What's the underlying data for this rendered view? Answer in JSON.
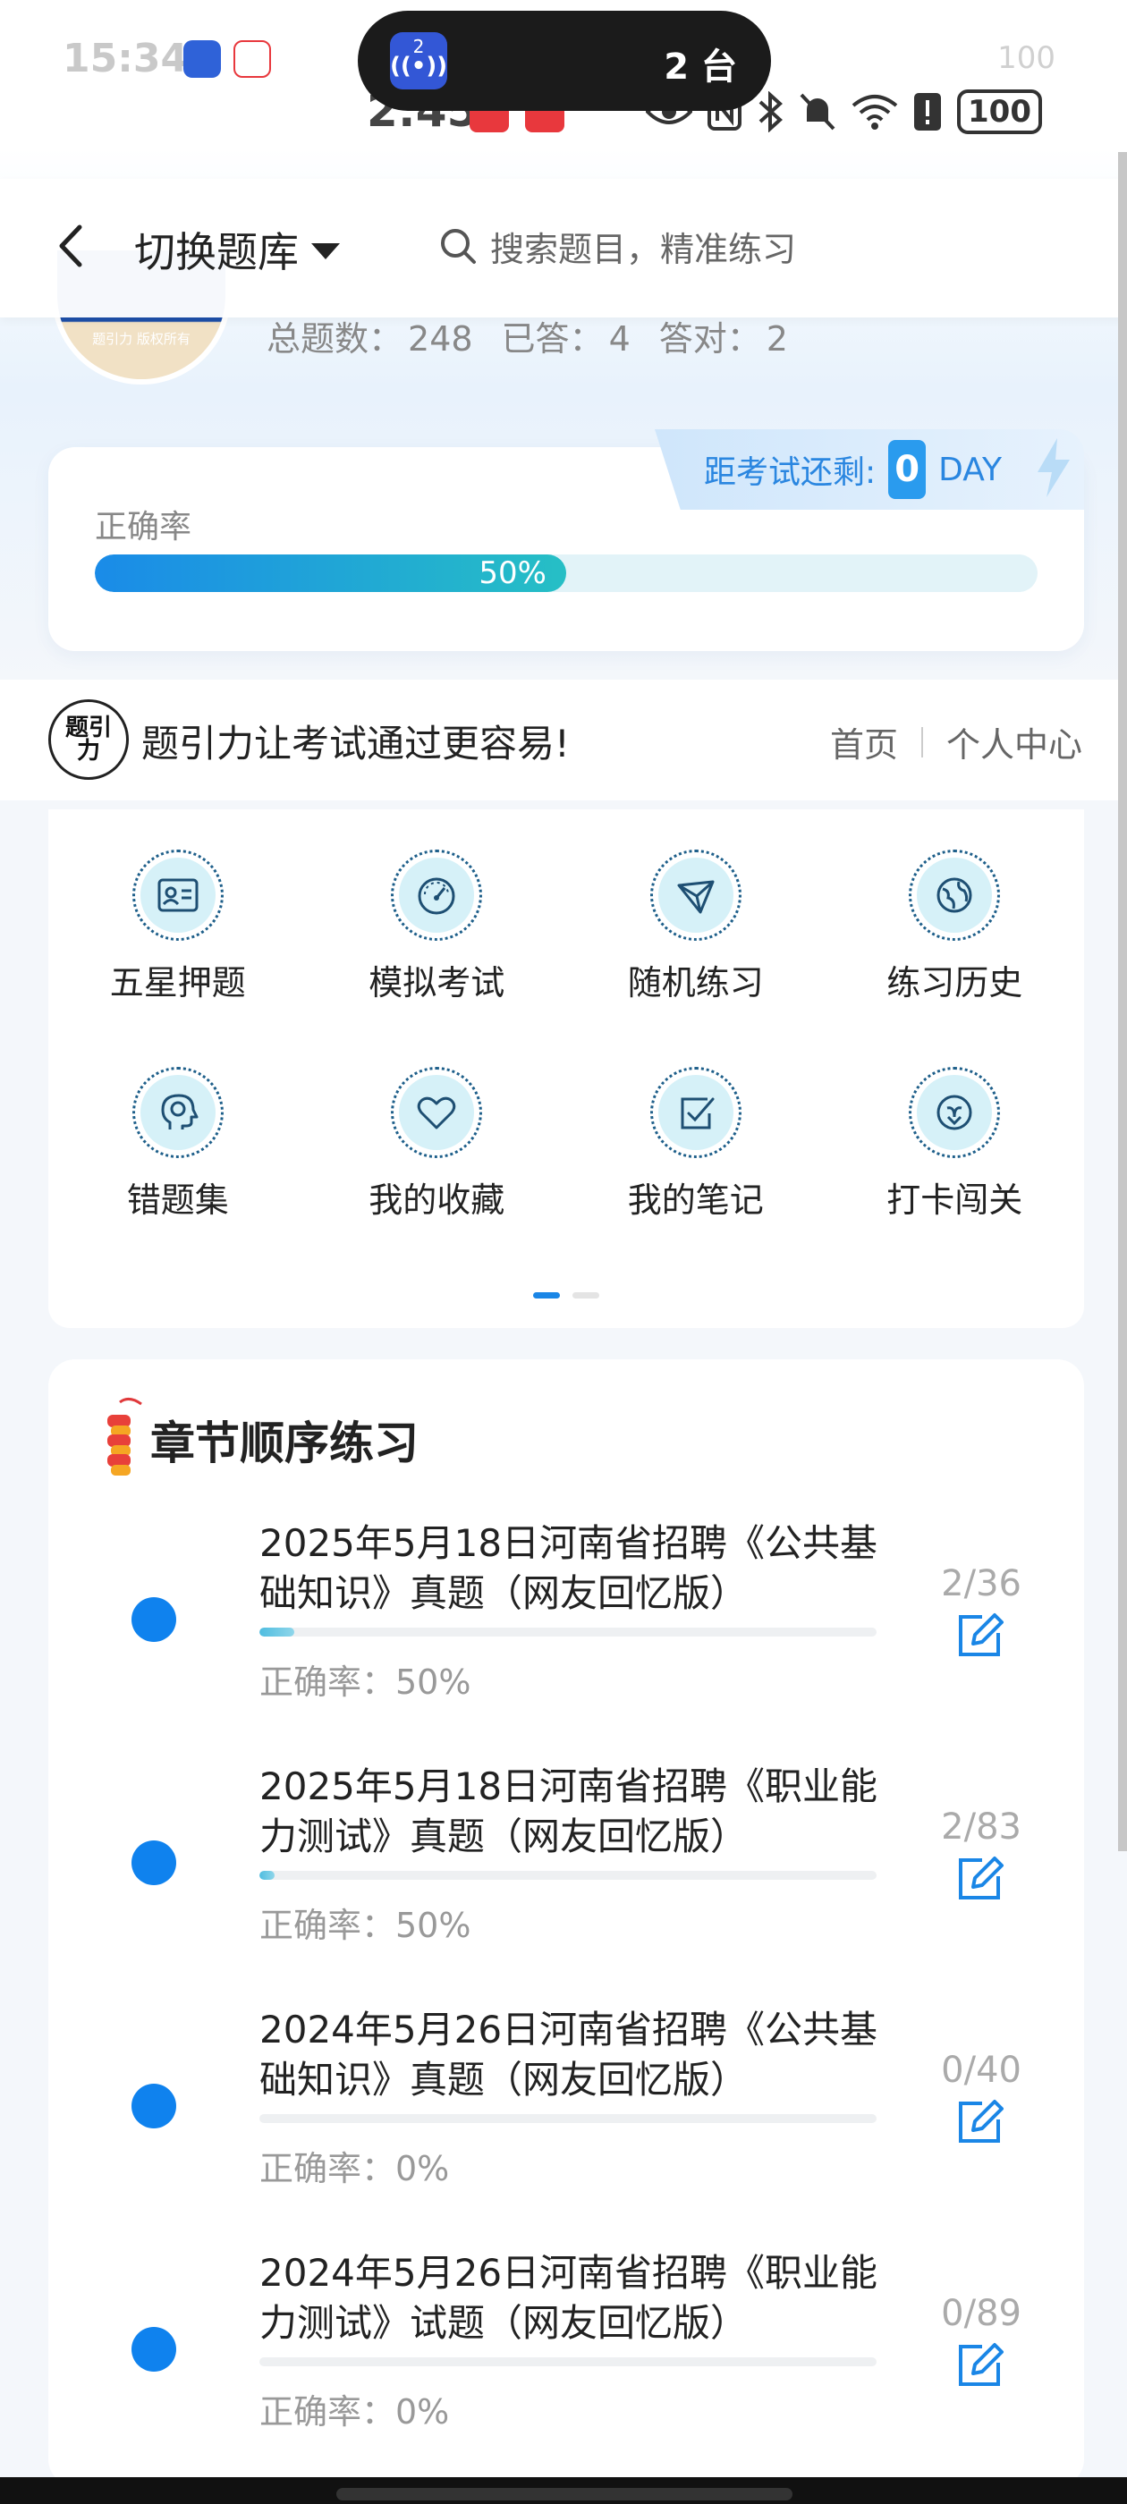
{
  "status_bar": {
    "time": "2:45",
    "ghost_time": "15:34",
    "ghost_battery": "100",
    "battery": "100",
    "cast_count": "2",
    "cast_devices": "2 台"
  },
  "nav": {
    "switch_bank_label": "切换题库",
    "search_placeholder": "搜索题目，精准练习"
  },
  "profile": {
    "copyright": "题引力 版权所有",
    "stats": [
      {
        "label": "总题数：",
        "value": "248"
      },
      {
        "label": "已答：",
        "value": "4"
      },
      {
        "label": "答对：",
        "value": "2"
      }
    ]
  },
  "accuracy": {
    "label": "正确率",
    "percent_text": "50%",
    "percent_value": 50,
    "countdown_label": "距考试还剩:",
    "countdown_days": "0",
    "countdown_unit": "DAY"
  },
  "brand": {
    "logo_text": "题引力",
    "slogan": "题引力让考试通过更容易!",
    "link_home": "首页",
    "link_profile": "个人中心"
  },
  "features": [
    {
      "label": "五星押题",
      "icon": "id-card-icon"
    },
    {
      "label": "模拟考试",
      "icon": "speedometer-icon"
    },
    {
      "label": "随机练习",
      "icon": "random-cube-icon"
    },
    {
      "label": "练习历史",
      "icon": "globe-history-icon"
    },
    {
      "label": "错题集",
      "icon": "head-brain-icon"
    },
    {
      "label": "我的收藏",
      "icon": "heart-icon"
    },
    {
      "label": "我的笔记",
      "icon": "note-check-icon"
    },
    {
      "label": "打卡闯关",
      "icon": "badge-check-icon"
    }
  ],
  "pager": {
    "pages": 2,
    "active": 0
  },
  "chapter": {
    "title": "章节顺序练习",
    "items": [
      {
        "title": "2025年5月18日河南省招聘《公共基础知识》真题（网友回忆版）",
        "accuracy": "正确率：50%",
        "progress": "2/36",
        "done_fraction": 0.056
      },
      {
        "title": "2025年5月18日河南省招聘《职业能力测试》真题（网友回忆版）",
        "accuracy": "正确率：50%",
        "progress": "2/83",
        "done_fraction": 0.024
      },
      {
        "title": "2024年5月26日河南省招聘《公共基础知识》真题（网友回忆版）",
        "accuracy": "正确率：0%",
        "progress": "0/40",
        "done_fraction": 0
      },
      {
        "title": "2024年5月26日河南省招聘《职业能力测试》试题（网友回忆版）",
        "accuracy": "正确率：0%",
        "progress": "0/89",
        "done_fraction": 0
      }
    ]
  },
  "colors": {
    "accent": "#0f82ee",
    "progress_start": "#1a8be8",
    "progress_end": "#26bfc5",
    "icon_bg": "#d6f1f8"
  }
}
